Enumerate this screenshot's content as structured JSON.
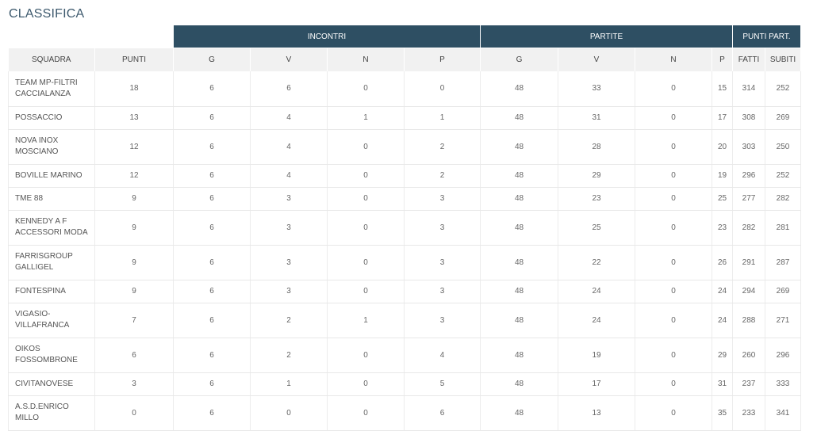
{
  "page": {
    "title": "CLASSIFICA"
  },
  "groups": {
    "incontri": "INCONTRI",
    "partite": "PARTITE",
    "punti_part": "PUNTI PART."
  },
  "columns": {
    "squadra": "SQUADRA",
    "punti": "PUNTI",
    "inc_g": "G",
    "inc_v": "V",
    "inc_n": "N",
    "inc_p": "P",
    "par_g": "G",
    "par_v": "V",
    "par_n": "N",
    "par_p": "P",
    "fatti": "FATTI",
    "subiti": "SUBITI"
  },
  "rows": [
    {
      "team": [
        "TEAM MP-FILTRI",
        "CACCIALANZA"
      ],
      "punti": "18",
      "inc_g": "6",
      "inc_v": "6",
      "inc_n": "0",
      "inc_p": "0",
      "par_g": "48",
      "par_v": "33",
      "par_n": "0",
      "par_p": "15",
      "fatti": "314",
      "subiti": "252"
    },
    {
      "team": [
        "POSSACCIO"
      ],
      "punti": "13",
      "inc_g": "6",
      "inc_v": "4",
      "inc_n": "1",
      "inc_p": "1",
      "par_g": "48",
      "par_v": "31",
      "par_n": "0",
      "par_p": "17",
      "fatti": "308",
      "subiti": "269"
    },
    {
      "team": [
        "NOVA INOX",
        "MOSCIANO"
      ],
      "punti": "12",
      "inc_g": "6",
      "inc_v": "4",
      "inc_n": "0",
      "inc_p": "2",
      "par_g": "48",
      "par_v": "28",
      "par_n": "0",
      "par_p": "20",
      "fatti": "303",
      "subiti": "250"
    },
    {
      "team": [
        "BOVILLE MARINO"
      ],
      "punti": "12",
      "inc_g": "6",
      "inc_v": "4",
      "inc_n": "0",
      "inc_p": "2",
      "par_g": "48",
      "par_v": "29",
      "par_n": "0",
      "par_p": "19",
      "fatti": "296",
      "subiti": "252"
    },
    {
      "team": [
        "TME 88"
      ],
      "punti": "9",
      "inc_g": "6",
      "inc_v": "3",
      "inc_n": "0",
      "inc_p": "3",
      "par_g": "48",
      "par_v": "23",
      "par_n": "0",
      "par_p": "25",
      "fatti": "277",
      "subiti": "282"
    },
    {
      "team": [
        "KENNEDY A F",
        "ACCESSORI MODA"
      ],
      "punti": "9",
      "inc_g": "6",
      "inc_v": "3",
      "inc_n": "0",
      "inc_p": "3",
      "par_g": "48",
      "par_v": "25",
      "par_n": "0",
      "par_p": "23",
      "fatti": "282",
      "subiti": "281"
    },
    {
      "team": [
        "FARRISGROUP",
        "GALLIGEL"
      ],
      "punti": "9",
      "inc_g": "6",
      "inc_v": "3",
      "inc_n": "0",
      "inc_p": "3",
      "par_g": "48",
      "par_v": "22",
      "par_n": "0",
      "par_p": "26",
      "fatti": "291",
      "subiti": "287"
    },
    {
      "team": [
        "FONTESPINA"
      ],
      "punti": "9",
      "inc_g": "6",
      "inc_v": "3",
      "inc_n": "0",
      "inc_p": "3",
      "par_g": "48",
      "par_v": "24",
      "par_n": "0",
      "par_p": "24",
      "fatti": "294",
      "subiti": "269"
    },
    {
      "team": [
        "VIGASIO-",
        "VILLAFRANCA"
      ],
      "punti": "7",
      "inc_g": "6",
      "inc_v": "2",
      "inc_n": "1",
      "inc_p": "3",
      "par_g": "48",
      "par_v": "24",
      "par_n": "0",
      "par_p": "24",
      "fatti": "288",
      "subiti": "271"
    },
    {
      "team": [
        "OIKOS",
        "FOSSOMBRONE"
      ],
      "punti": "6",
      "inc_g": "6",
      "inc_v": "2",
      "inc_n": "0",
      "inc_p": "4",
      "par_g": "48",
      "par_v": "19",
      "par_n": "0",
      "par_p": "29",
      "fatti": "260",
      "subiti": "296"
    },
    {
      "team": [
        "CIVITANOVESE"
      ],
      "punti": "3",
      "inc_g": "6",
      "inc_v": "1",
      "inc_n": "0",
      "inc_p": "5",
      "par_g": "48",
      "par_v": "17",
      "par_n": "0",
      "par_p": "31",
      "fatti": "237",
      "subiti": "333"
    },
    {
      "team": [
        "A.S.D.ENRICO",
        "MILLO"
      ],
      "punti": "0",
      "inc_g": "6",
      "inc_v": "0",
      "inc_n": "0",
      "inc_p": "6",
      "par_g": "48",
      "par_v": "13",
      "par_n": "0",
      "par_p": "35",
      "fatti": "233",
      "subiti": "341"
    }
  ]
}
